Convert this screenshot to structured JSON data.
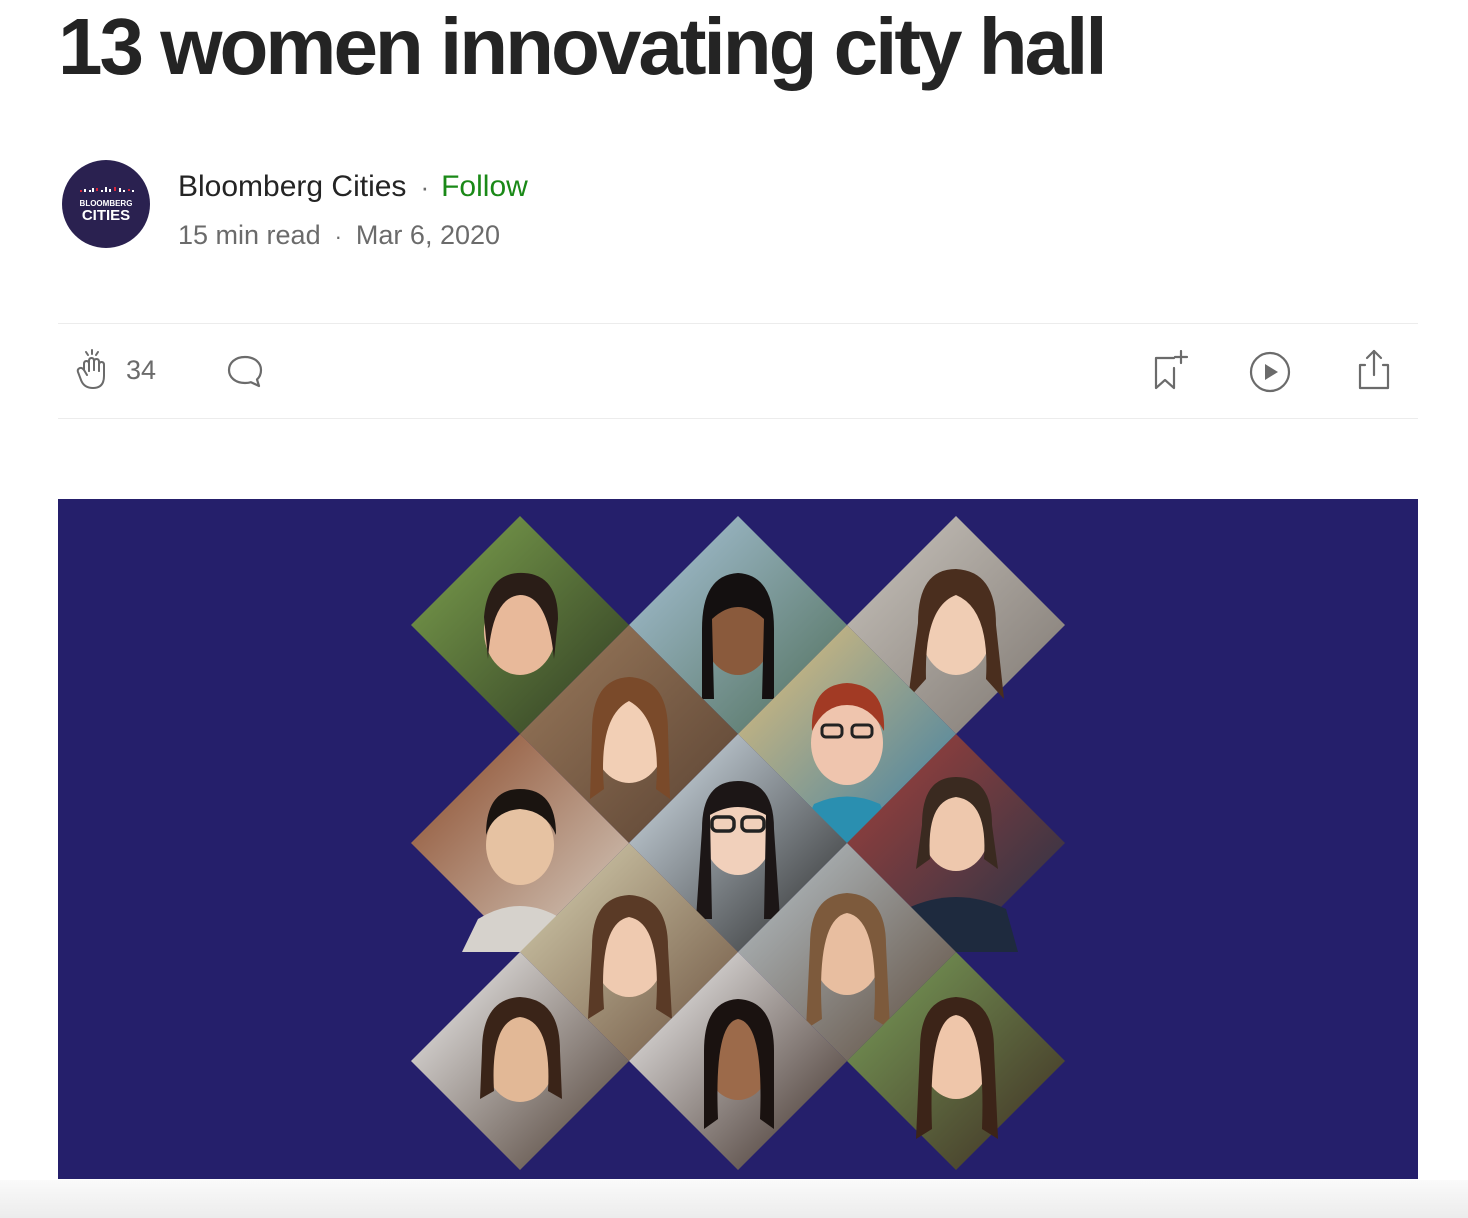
{
  "article": {
    "title": "13 women innovating city hall"
  },
  "author": {
    "name": "Bloomberg Cities",
    "follow_label": "Follow",
    "avatar_line1": "BLOOMBERG",
    "avatar_line2": "CITIES"
  },
  "meta": {
    "read_time": "15 min read",
    "date": "Mar 6, 2020",
    "separator": "·"
  },
  "actions": {
    "clap_count": "34",
    "icons": [
      "clap-icon",
      "comment-icon",
      "bookmark-add-icon",
      "play-icon",
      "share-icon"
    ]
  },
  "hero": {
    "background_color": "#251f6b",
    "tile_count": 13
  },
  "colors": {
    "follow": "#1a8917",
    "text": "#242424",
    "muted": "#6b6b6b"
  }
}
